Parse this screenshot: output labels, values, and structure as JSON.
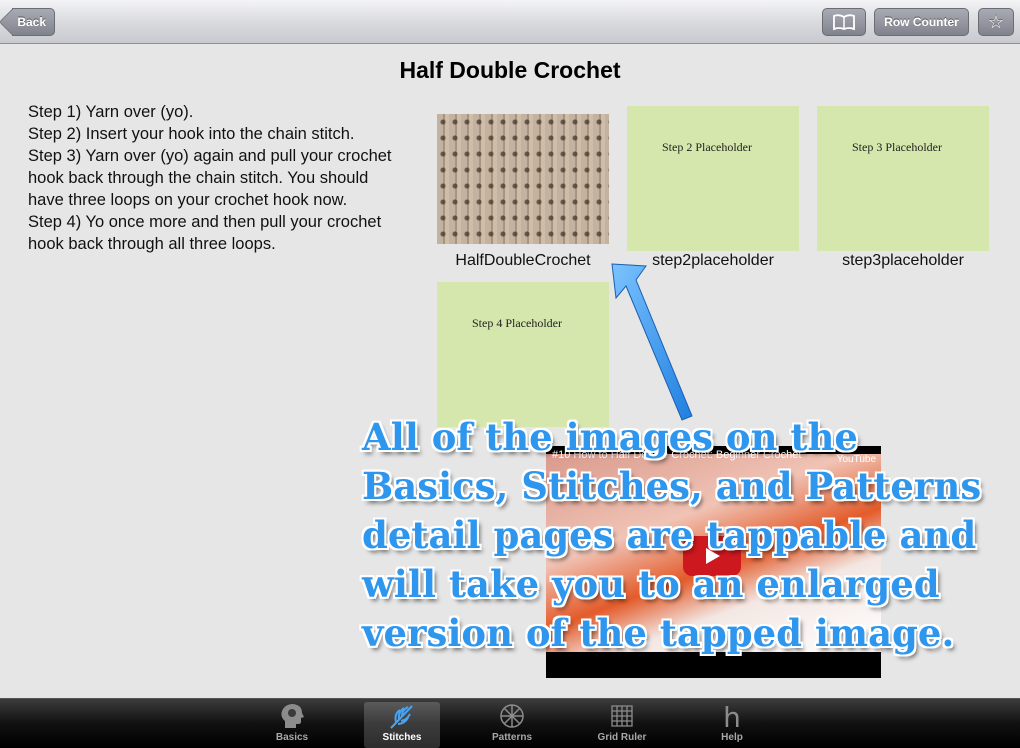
{
  "navbar": {
    "back_label": "Back",
    "book_icon": "book-icon",
    "row_counter_label": "Row Counter",
    "star_icon": "star-icon",
    "star_glyph": "☆",
    "book_glyph": "📖"
  },
  "page": {
    "title": "Half Double Crochet",
    "instructions": [
      "Step 1) Yarn over (yo).",
      "Step 2) Insert your hook into the chain stitch.",
      "Step 3) Yarn over (yo) again and pull your crochet hook back through the chain stitch. You should have three loops on your crochet hook now.",
      "Step 4) Yo once more and then pull your crochet hook back through all three loops."
    ]
  },
  "thumbnails": [
    {
      "caption": "HalfDoubleCrochet",
      "placeholder_text": ""
    },
    {
      "caption": "step2placeholder",
      "placeholder_text": "Step 2 Placeholder"
    },
    {
      "caption": "step3placeholder",
      "placeholder_text": "Step 3 Placeholder"
    },
    {
      "caption": "",
      "placeholder_text": "Step 4 Placeholder"
    }
  ],
  "video": {
    "title": "#10 How to Half Double Crochet: Beginner Crochet",
    "provider": "YouTube"
  },
  "overlay": {
    "text": "All of the images on the Basics, Stitches, and Patterns detail pages are tappable and will take you to an enlarged version of the tapped image.",
    "color": "#2f96ee"
  },
  "tabbar": {
    "tabs": [
      {
        "label": "Basics",
        "icon": "head-icon"
      },
      {
        "label": "Stitches",
        "icon": "feather-icon"
      },
      {
        "label": "Patterns",
        "icon": "snowflake-icon"
      },
      {
        "label": "Grid Ruler",
        "icon": "grid-icon"
      },
      {
        "label": "Help",
        "icon": "help-icon"
      }
    ],
    "active_tab": "Stitches"
  }
}
